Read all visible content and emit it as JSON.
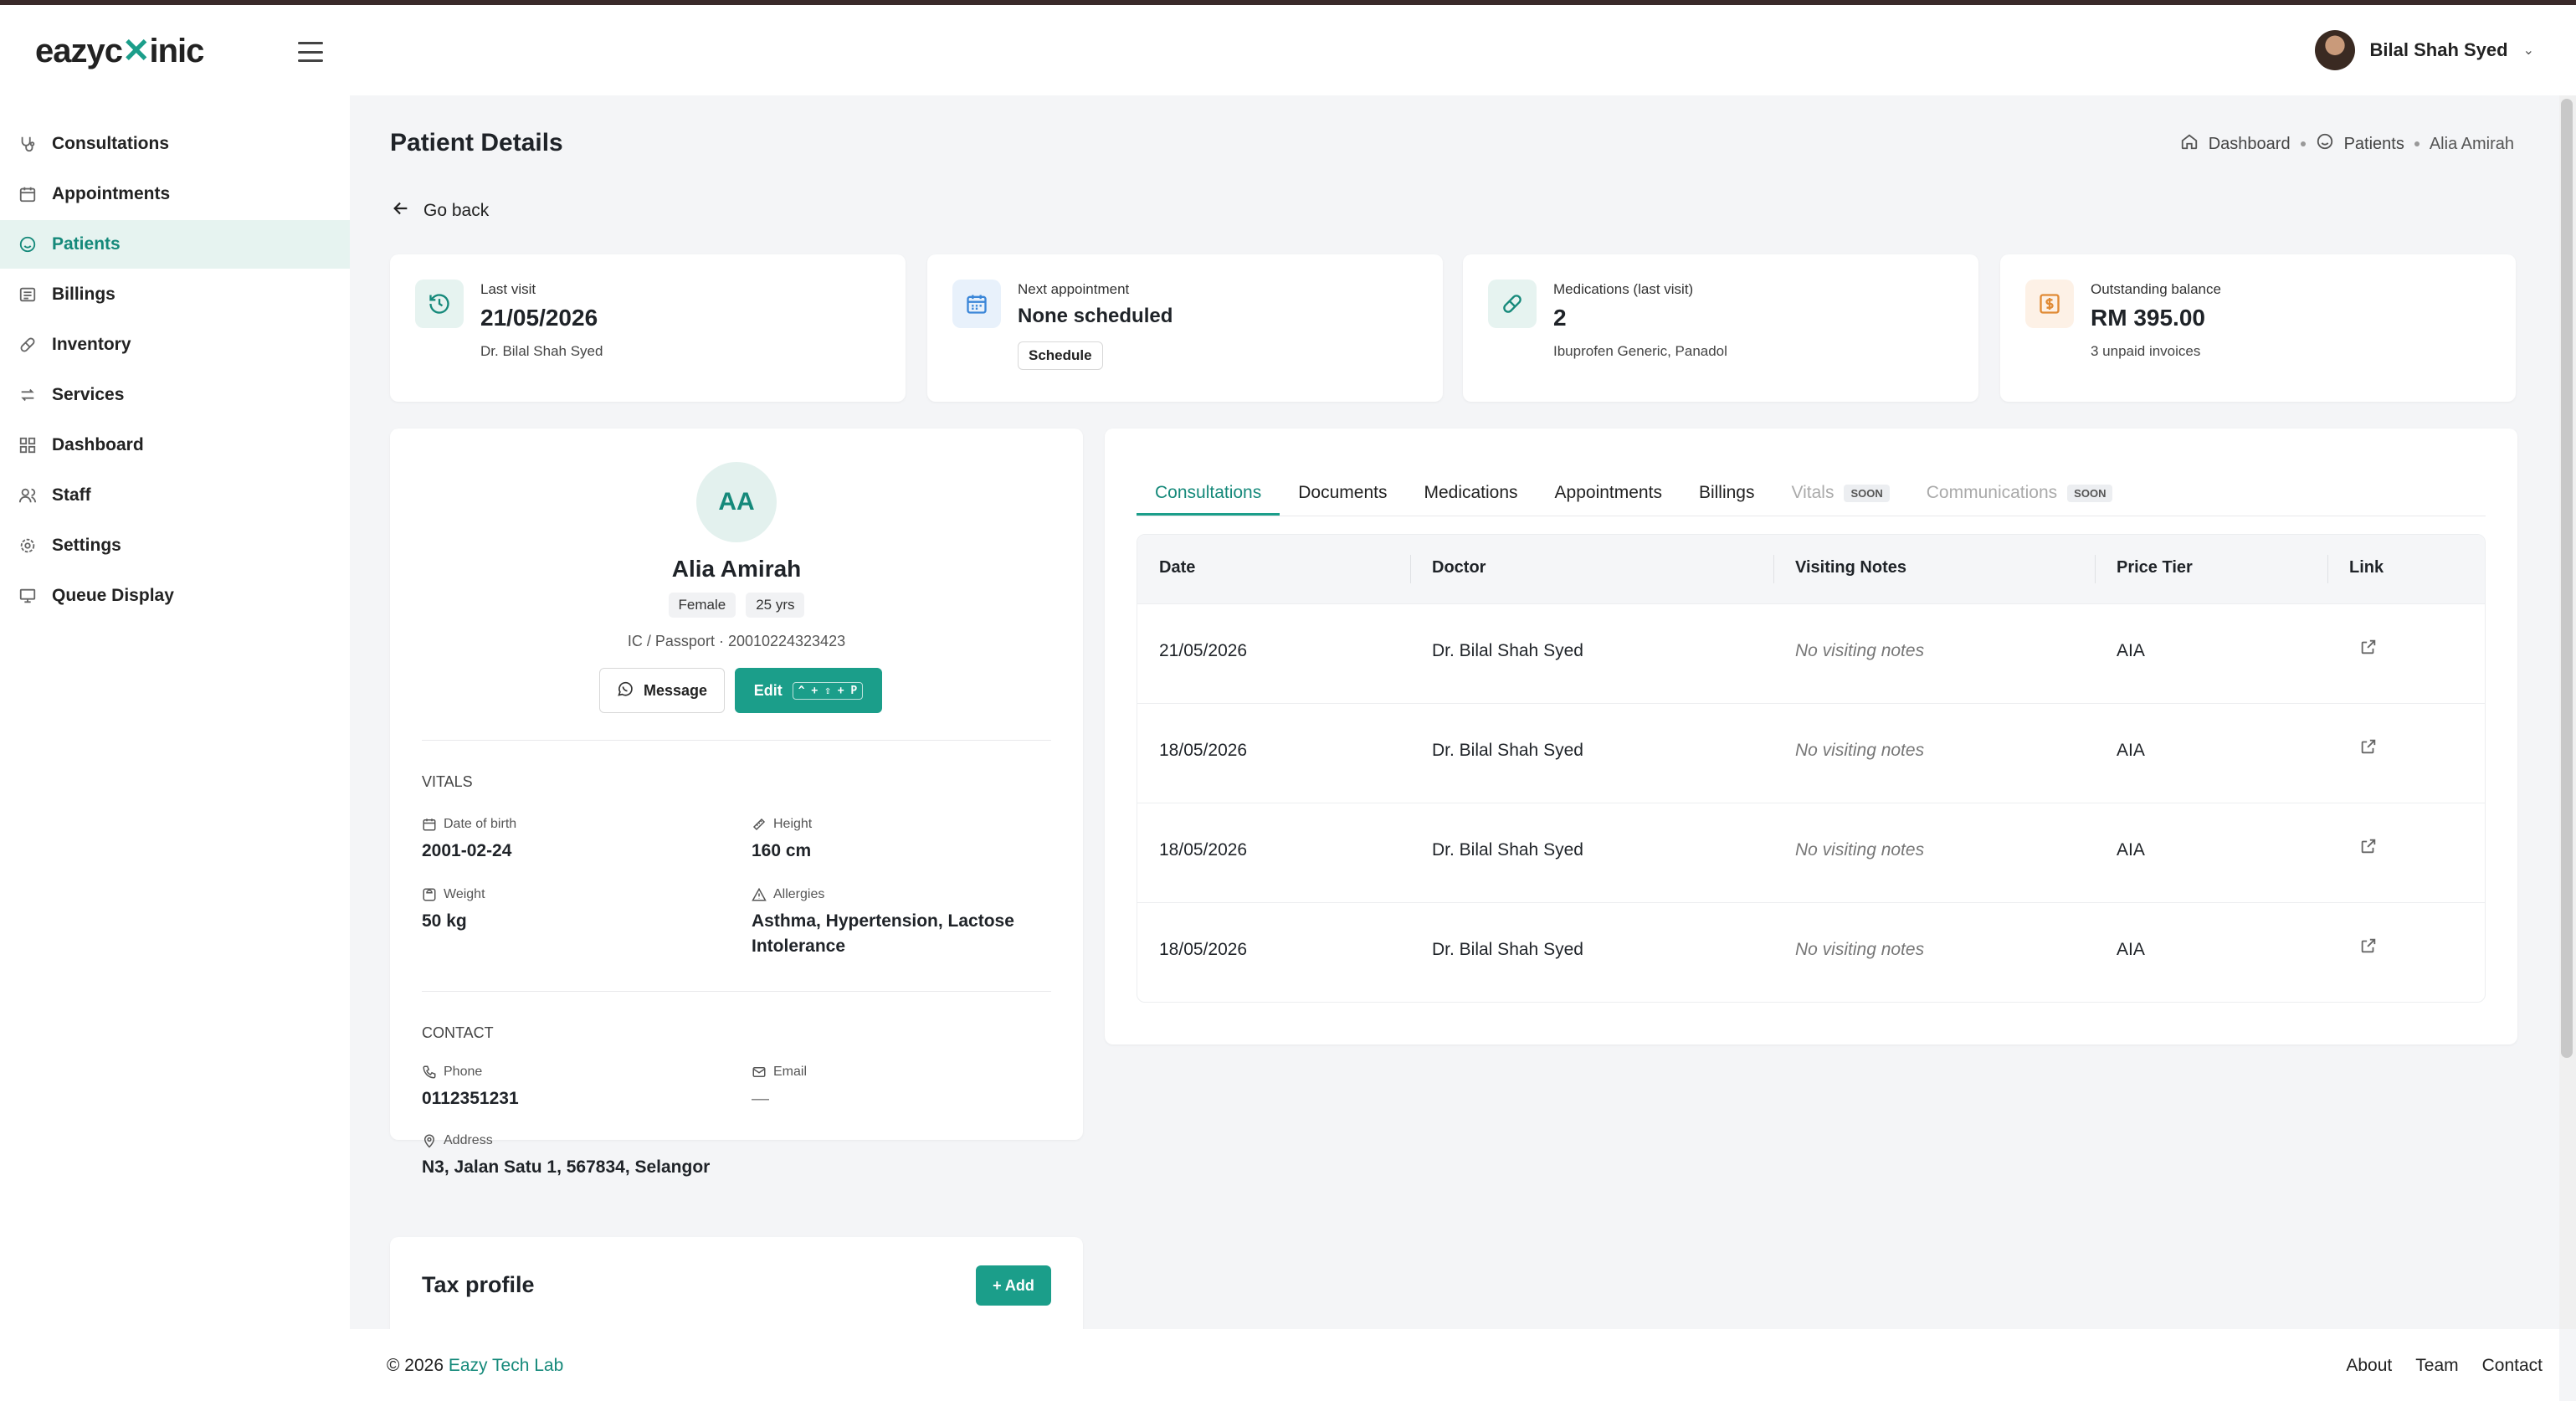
{
  "app": {
    "logo_text_a": "eazyc",
    "logo_text_b": "inic",
    "logo_mark": "✕"
  },
  "user": {
    "name": "Bilal Shah Syed"
  },
  "sidebar": {
    "items": [
      {
        "label": "Consultations",
        "icon": "stethoscope-icon"
      },
      {
        "label": "Appointments",
        "icon": "calendar-icon"
      },
      {
        "label": "Patients",
        "icon": "smile-icon",
        "active": true
      },
      {
        "label": "Billings",
        "icon": "invoice-icon"
      },
      {
        "label": "Inventory",
        "icon": "pill-icon"
      },
      {
        "label": "Services",
        "icon": "arrows-icon"
      },
      {
        "label": "Dashboard",
        "icon": "grid-icon"
      },
      {
        "label": "Staff",
        "icon": "users-icon"
      },
      {
        "label": "Settings",
        "icon": "gear-icon"
      },
      {
        "label": "Queue Display",
        "icon": "monitor-icon"
      }
    ]
  },
  "page": {
    "title": "Patient Details",
    "go_back": "Go back",
    "breadcrumb": {
      "home": "Dashboard",
      "section": "Patients",
      "current": "Alia Amirah"
    }
  },
  "stats": {
    "last_visit": {
      "label": "Last visit",
      "value": "21/05/2026",
      "sub": "Dr. Bilal Shah Syed"
    },
    "next_appointment": {
      "label": "Next appointment",
      "value": "None scheduled",
      "button": "Schedule"
    },
    "medications": {
      "label": "Medications (last visit)",
      "value": "2",
      "sub": "Ibuprofen Generic, Panadol"
    },
    "balance": {
      "label": "Outstanding balance",
      "value": "RM 395.00",
      "sub": "3 unpaid invoices"
    }
  },
  "profile": {
    "initials": "AA",
    "name": "Alia Amirah",
    "gender": "Female",
    "age": "25 yrs",
    "ic": "IC / Passport · 20010224323423",
    "message_button": "Message",
    "edit_button": "Edit",
    "edit_shortcut": "^ + ⇧ + P",
    "vitals_heading": "VITALS",
    "dob_label": "Date of birth",
    "dob": "2001-02-24",
    "height_label": "Height",
    "height": "160 cm",
    "weight_label": "Weight",
    "weight": "50 kg",
    "allergies_label": "Allergies",
    "allergies": "Asthma, Hypertension, Lactose Intolerance",
    "contact_heading": "CONTACT",
    "phone_label": "Phone",
    "phone": "0112351231",
    "email_label": "Email",
    "email": "—",
    "address_label": "Address",
    "address": "N3, Jalan Satu 1, 567834, Selangor"
  },
  "tax": {
    "title": "Tax profile",
    "add_button": "+ Add"
  },
  "tabs": [
    {
      "label": "Consultations",
      "active": true
    },
    {
      "label": "Documents"
    },
    {
      "label": "Medications"
    },
    {
      "label": "Appointments"
    },
    {
      "label": "Billings"
    },
    {
      "label": "Vitals",
      "badge": "SOON",
      "disabled": true
    },
    {
      "label": "Communications",
      "badge": "SOON",
      "disabled": true
    }
  ],
  "table": {
    "columns": [
      "Date",
      "Doctor",
      "Visiting Notes",
      "Price Tier",
      "Link"
    ],
    "rows": [
      {
        "date": "21/05/2026",
        "doctor": "Dr. Bilal Shah Syed",
        "notes": "No visiting notes",
        "tier": "AIA"
      },
      {
        "date": "18/05/2026",
        "doctor": "Dr. Bilal Shah Syed",
        "notes": "No visiting notes",
        "tier": "AIA"
      },
      {
        "date": "18/05/2026",
        "doctor": "Dr. Bilal Shah Syed",
        "notes": "No visiting notes",
        "tier": "AIA"
      },
      {
        "date": "18/05/2026",
        "doctor": "Dr. Bilal Shah Syed",
        "notes": "No visiting notes",
        "tier": "AIA"
      }
    ]
  },
  "footer": {
    "copyright": "© 2026",
    "company": "Eazy Tech Lab",
    "links": [
      "About",
      "Team",
      "Contact"
    ]
  },
  "colors": {
    "accent": "#1b9e8a",
    "accent_text": "#15897a",
    "background": "#f4f5f7"
  }
}
